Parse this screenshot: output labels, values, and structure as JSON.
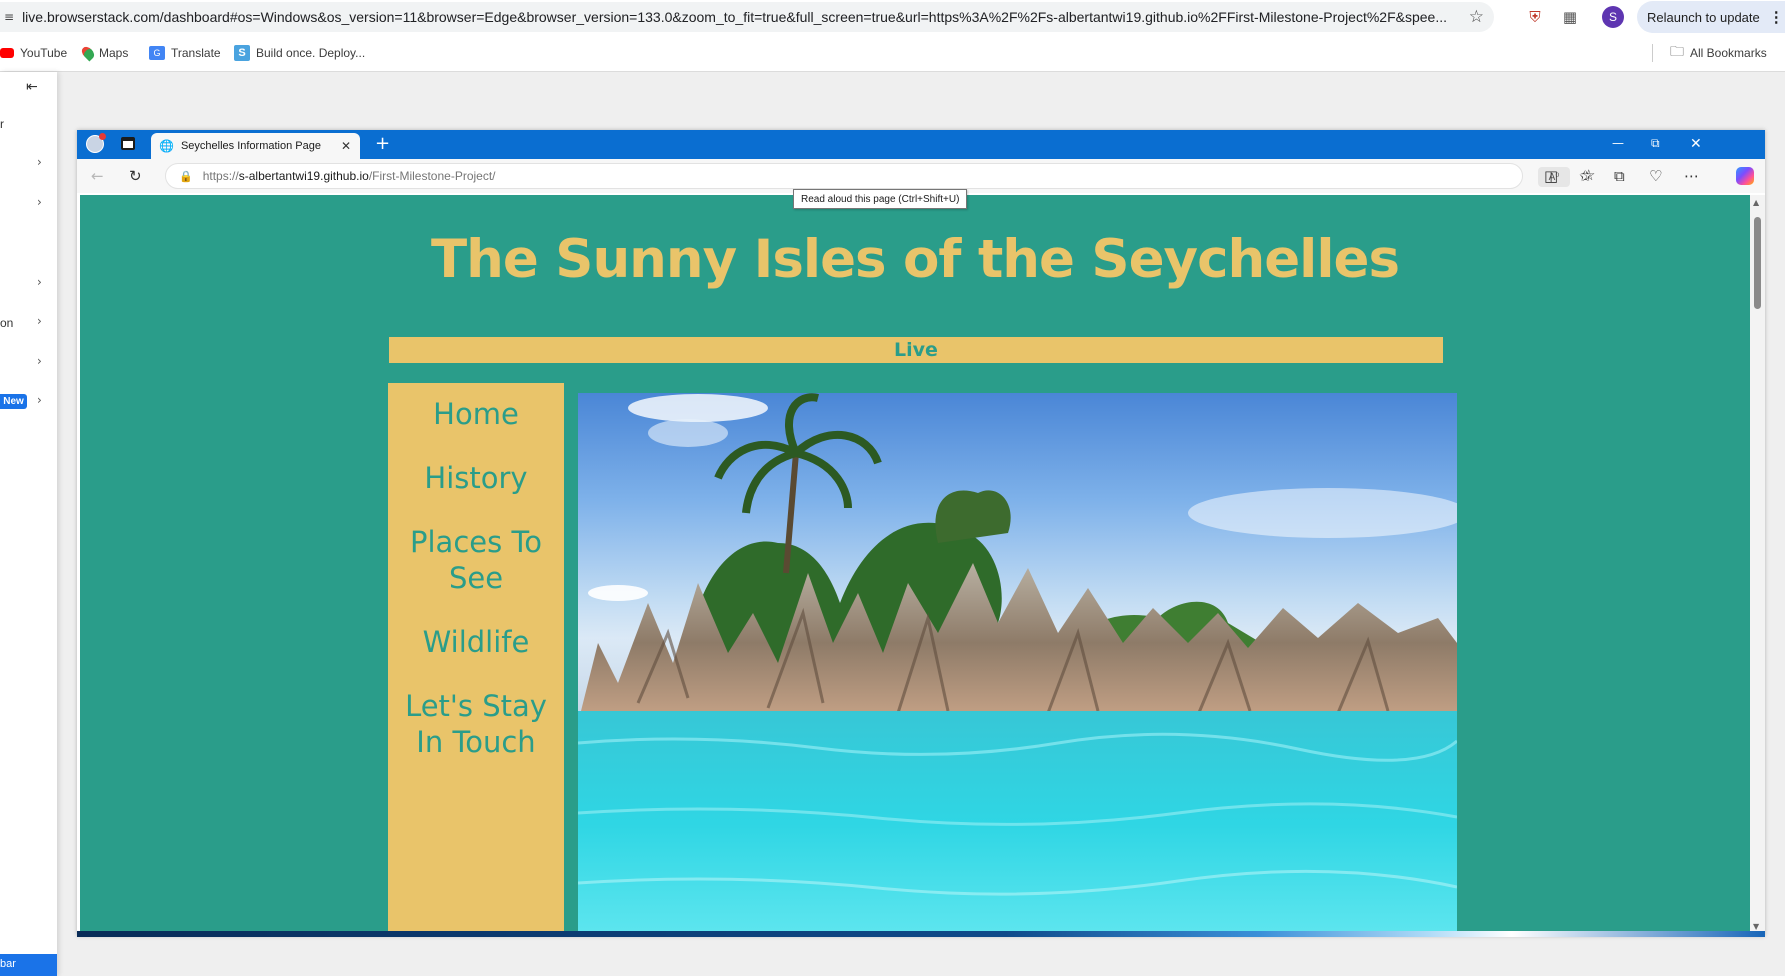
{
  "host_browser": {
    "url": "live.browserstack.com/dashboard#os=Windows&os_version=11&browser=Edge&browser_version=133.0&zoom_to_fit=true&full_screen=true&url=https%3A%2F%2Fs-albertantwi19.github.io%2FFirst-Milestone-Project%2F&spee...",
    "profile_initial": "S",
    "relaunch_label": "Relaunch to update",
    "bookmarks": [
      {
        "label": "YouTube",
        "icon": "youtube-icon"
      },
      {
        "label": "Maps",
        "icon": "maps-icon"
      },
      {
        "label": "Translate",
        "icon": "translate-icon"
      },
      {
        "label": "Build once. Deploy...",
        "icon": "browserstack-icon"
      }
    ],
    "all_bookmarks_label": "All Bookmarks"
  },
  "browserstack_panel": {
    "fragments": [
      "r",
      "on",
      "bar"
    ],
    "new_badge": "New"
  },
  "remote_browser": {
    "tab_title": "Seychelles Information Page",
    "url_scheme": "https://",
    "url_domain": "s-albertantwi19.github.io",
    "url_path": "/First-Milestone-Project/",
    "read_aloud_label": "A⁰",
    "tooltip": "Read aloud this page (Ctrl+Shift+U)"
  },
  "site": {
    "title": "The Sunny Isles of the Seychelles",
    "banner": "Live",
    "nav": [
      "Home",
      "History",
      "Places To See",
      "Wildlife",
      "Let's Stay In Touch"
    ]
  },
  "colors": {
    "page_bg": "#2a9d8a",
    "accent_yellow": "#e9c46a",
    "edge_titlebar": "#0a6ed1"
  }
}
